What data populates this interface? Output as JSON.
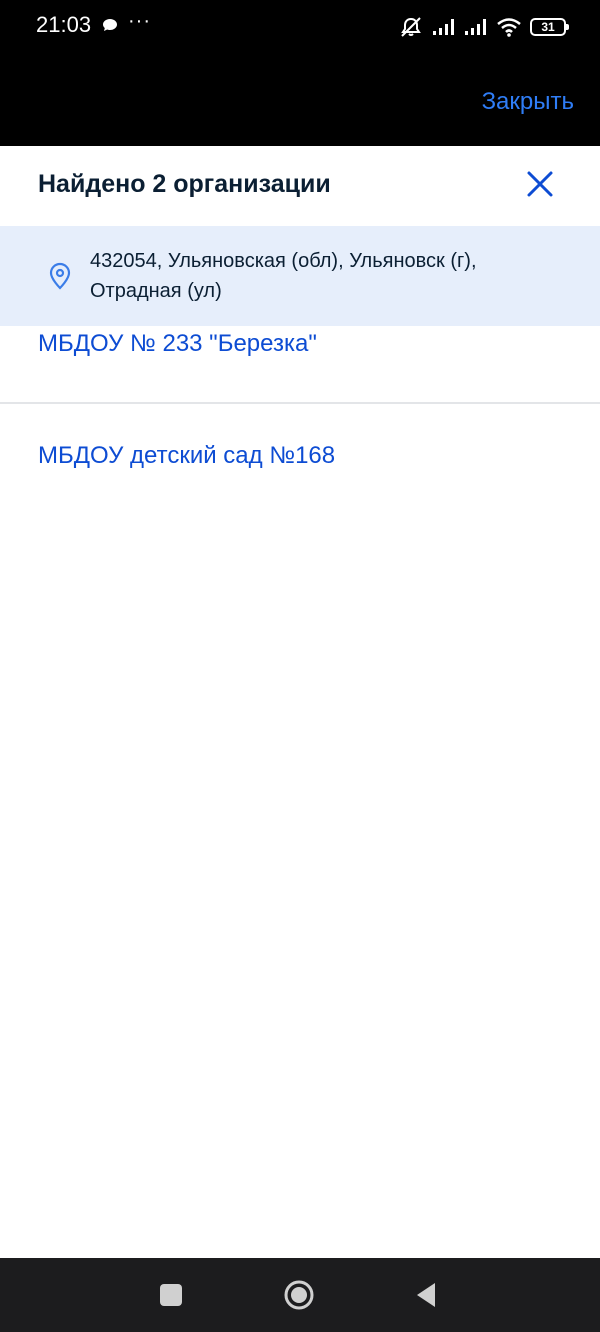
{
  "status_bar": {
    "time": "21:03",
    "more": "···",
    "battery": "31"
  },
  "header": {
    "close_link": "Закрыть"
  },
  "sheet": {
    "title": "Найдено 2 организации",
    "address": "432054, Ульяновская (обл), Ульяновск (г), Отрадная (ул)"
  },
  "organizations": [
    {
      "name": "МБДОУ № 233 \"Березка\""
    },
    {
      "name": "МБДОУ детский сад №168"
    }
  ],
  "icons": {
    "chat": "chat-bubble-icon",
    "mute": "mute-icon",
    "signal": "signal-icon",
    "wifi": "wifi-icon",
    "close": "close-icon",
    "location": "location-pin-icon",
    "recent": "recent-apps-icon",
    "home": "home-icon",
    "back": "back-icon"
  },
  "colors": {
    "link": "#2f7df6",
    "org_link": "#0d4cd3",
    "banner_bg": "#e6eefb",
    "title": "#0b1f33"
  }
}
